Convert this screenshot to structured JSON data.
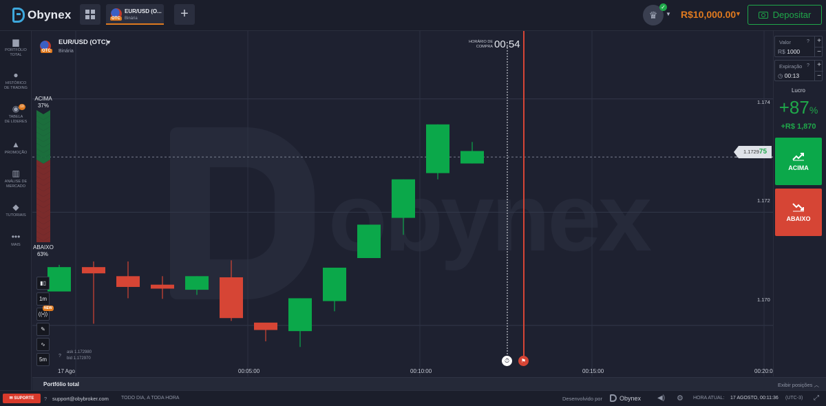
{
  "brand": {
    "name": "Obynex",
    "accent": "#3ea8dc"
  },
  "header": {
    "asset_tab": {
      "name": "EUR/USD (O...",
      "type": "Binária",
      "badge": "OTC"
    },
    "balance": "R$10,000.00",
    "deposit_label": "Depositar",
    "icons": [
      "grid-icon",
      "plus-icon",
      "crown-icon",
      "check-icon",
      "wallet-icon"
    ]
  },
  "sidebar": {
    "items": [
      {
        "label1": "PORTFÓLIO",
        "label2": "TOTAL",
        "icon": "briefcase-icon"
      },
      {
        "label1": "HISTÓRICO",
        "label2": "DE TRADING",
        "icon": "clock-icon"
      },
      {
        "label1": "TABELA",
        "label2": "DE LÍDERES",
        "icon": "leaderboard-icon",
        "badge": "10"
      },
      {
        "label1": "PROMOÇÃO",
        "label2": "",
        "icon": "rocket-icon"
      },
      {
        "label1": "ANÁLISE DE",
        "label2": "MERCADO",
        "icon": "chart-icon"
      },
      {
        "label1": "TUTORIAIS",
        "label2": "",
        "icon": "graduation-icon"
      },
      {
        "label1": "MAIS",
        "label2": "",
        "icon": "more-icon"
      }
    ]
  },
  "chart": {
    "asset_name": "EUR/USD (OTC)",
    "asset_type": "Binária",
    "purchase_time_label": "HORÁRIO DE COMPRA",
    "timer": "00:54",
    "sentiment_up_label": "ACIMA",
    "sentiment_up_pct": "37%",
    "sentiment_down_label": "ABAIXO",
    "sentiment_down_pct": "63%",
    "tools": [
      "1m",
      "5m"
    ],
    "new_badge": "NEW",
    "ask": "ask 1.172980",
    "bid": "bid 1.172970",
    "current_price_prefix": "1.1729",
    "current_price_suffix": "75",
    "date_label": "17 Ago",
    "colors": {
      "up": "#0ba84a",
      "down": "#d64535"
    }
  },
  "chart_data": {
    "type": "candlestick",
    "price_ticks": [
      "1.174",
      "1.172",
      "1.170"
    ],
    "time_ticks": [
      "00:05:00",
      "00:10:00",
      "00:15:00",
      "00:20:0"
    ],
    "ylim": [
      1.1691,
      1.1752
    ],
    "candles": [
      {
        "open": 1.1706,
        "close": 1.17103,
        "high": 1.17107,
        "low": 1.1706
      },
      {
        "open": 1.17103,
        "close": 1.17092,
        "high": 1.17113,
        "low": 1.17003
      },
      {
        "open": 1.17087,
        "close": 1.17068,
        "high": 1.17113,
        "low": 1.17048
      },
      {
        "open": 1.17072,
        "close": 1.17065,
        "high": 1.17087,
        "low": 1.17047
      },
      {
        "open": 1.17063,
        "close": 1.17087,
        "high": 1.17087,
        "low": 1.17054
      },
      {
        "open": 1.17085,
        "close": 1.17013,
        "high": 1.17115,
        "low": 1.17008
      },
      {
        "open": 1.17005,
        "close": 1.16992,
        "high": 1.17003,
        "low": 1.16972
      },
      {
        "open": 1.1699,
        "close": 1.17048,
        "high": 1.17048,
        "low": 1.16962
      },
      {
        "open": 1.17043,
        "close": 1.17102,
        "high": 1.17102,
        "low": 1.17025
      },
      {
        "open": 1.17119,
        "close": 1.17178,
        "high": 1.17178,
        "low": 1.17119
      },
      {
        "open": 1.1719,
        "close": 1.17258,
        "high": 1.17258,
        "low": 1.1716
      },
      {
        "open": 1.17269,
        "close": 1.17355,
        "high": 1.17355,
        "low": 1.17258
      },
      {
        "open": 1.17286,
        "close": 1.17308,
        "high": 1.17324,
        "low": 1.17286
      }
    ],
    "current_price": 1.172975
  },
  "right_panel": {
    "value_label": "Valor",
    "value_currency": "R$",
    "value_amount": "1000",
    "expiry_label": "Expiração",
    "expiry_value": "00:13",
    "profit_label": "Lucro",
    "profit_pct": "+87",
    "profit_pct_sign": "%",
    "profit_value": "+R$ 1,870",
    "up_button": "ACIMA",
    "down_button": "ABAIXO",
    "up_color": "#0ba84a",
    "down_color": "#d64535"
  },
  "bottom_panel": {
    "title": "Portfólio total",
    "toggle": "Exibir posições"
  },
  "footer": {
    "support": "SUPORTE",
    "email": "support@obybroker.com",
    "hours": "TODO DIA, A TODA HORA",
    "developed_by": "Desenvolvido por",
    "brand": "Obynex",
    "time_label": "HORA ATUAL:",
    "time_value": "17 AGOSTO, 00:11:36",
    "timezone": "(UTC-3)"
  }
}
